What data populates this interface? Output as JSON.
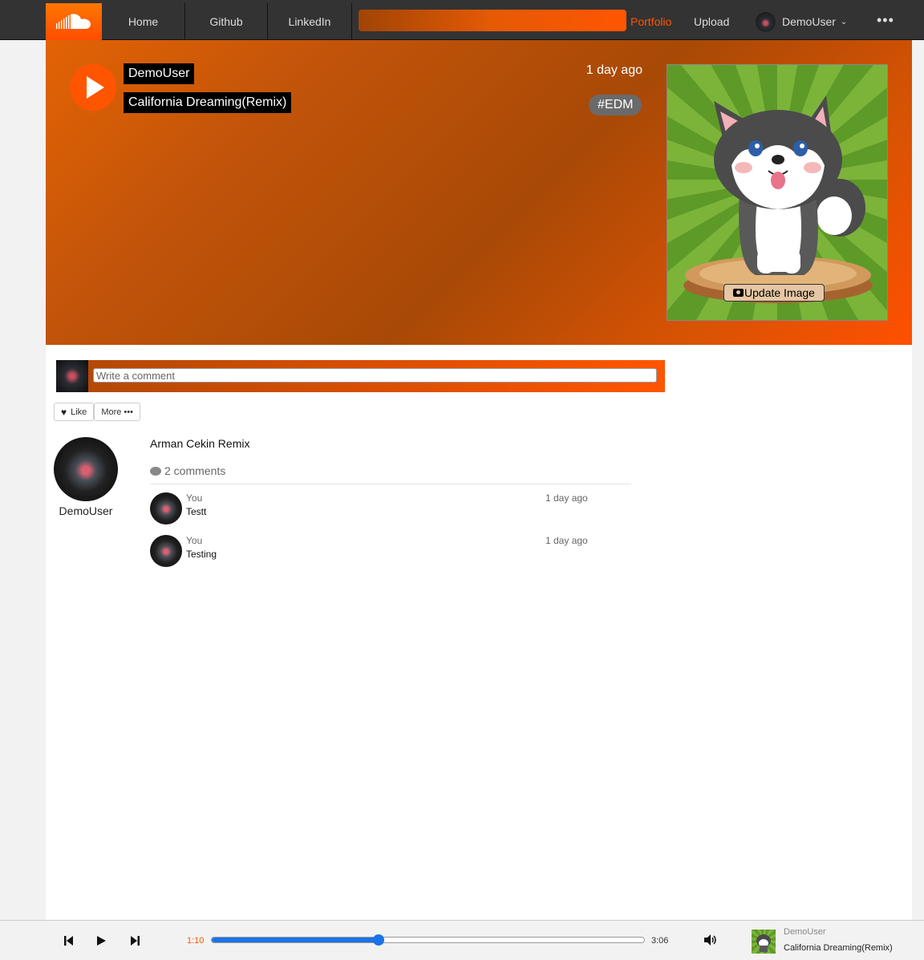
{
  "nav": {
    "home": "Home",
    "github": "Github",
    "linkedin": "LinkedIn",
    "portfolio": "Portfolio",
    "upload": "Upload",
    "user": "DemoUser",
    "more": "•••"
  },
  "track": {
    "user": "DemoUser",
    "title": "California Dreaming(Remix)",
    "time_ago": "1 day ago",
    "tag": "#EDM",
    "update_image_label": "Update Image"
  },
  "comment_box": {
    "placeholder": "Write a comment"
  },
  "actions": {
    "like": "Like",
    "more": "More •••"
  },
  "uploader": {
    "name": "DemoUser"
  },
  "description": "Arman Cekin Remix",
  "comments_count": "2 comments",
  "comments": [
    {
      "user": "You",
      "body": "Testt",
      "time": "1 day ago"
    },
    {
      "user": "You",
      "body": "Testing",
      "time": "1 day ago"
    }
  ],
  "player": {
    "current_time": "1:10",
    "duration": "3:06",
    "progress": 0.385,
    "user": "DemoUser",
    "title": "California Dreaming(Remix)"
  },
  "colors": {
    "brand": "#ff5500",
    "progress": "#1a73e8"
  }
}
